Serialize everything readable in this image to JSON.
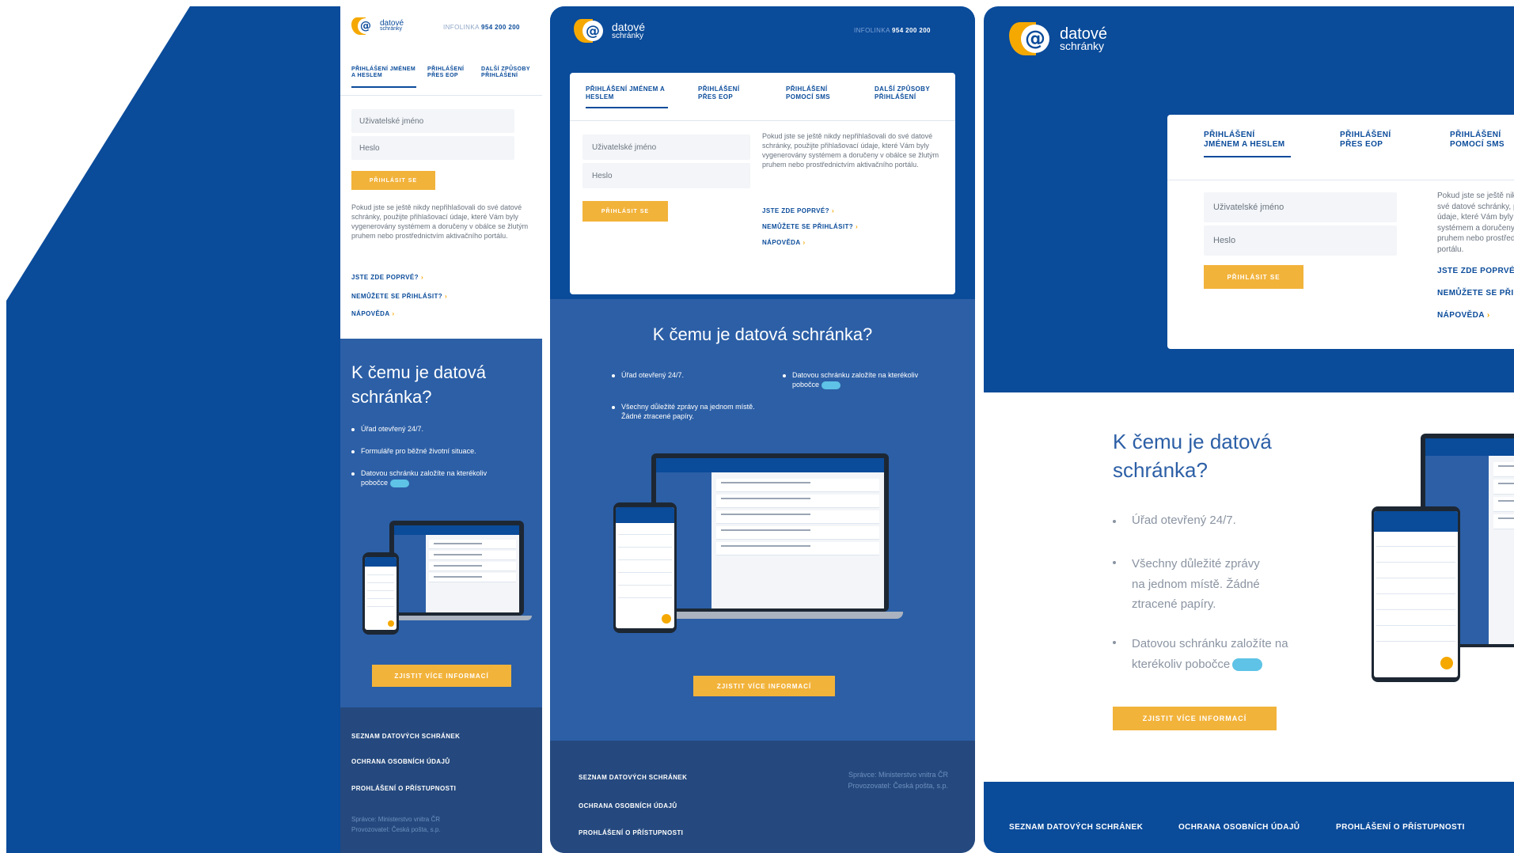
{
  "brand": {
    "name_line1": "datové",
    "name_line2": "schránky",
    "logo_char": "@"
  },
  "infolinka": {
    "label": "INFOLINKA",
    "number": "954 200 200"
  },
  "tabs": {
    "login_name": "PŘIHLÁŠENÍ JMÉNEM A HESLEM",
    "login_eop": "PŘIHLÁŠENÍ PŘES EOP",
    "login_sms": "PŘIHLÁŠENÍ POMOCÍ SMS",
    "login_other": "DALŠÍ ZPŮSOBY PŘIHLÁŠENÍ"
  },
  "form": {
    "username_placeholder": "Uživatelské jméno",
    "password_placeholder": "Heslo",
    "submit_label": "PŘIHLÁSIT SE"
  },
  "info_text": "Pokud jste se ještě nikdy nepřihlašovali do své datové schránky, použijte přihlašovací údaje, které Vám byly vygenerovány systémem a doručeny v obálce se žlutým pruhem nebo prostřednictvím aktivačního portálu.",
  "links": {
    "first_time": "JSTE ZDE POPRVÉ?",
    "cannot_login": "NEMŮŽETE SE PŘIHLÁSIT?",
    "help": "NÁPOVĚDA"
  },
  "about": {
    "heading": "K čemu je datová schránka?",
    "bullet_office": "Úřad otevřený 24/7.",
    "bullet_forms": "Formuláře pro běžné životní situace.",
    "bullet_messages": "Všechny důležité zprávy na jednom místě. Žádné ztracené papíry.",
    "bullet_branch": "Datovou schránku založíte na kterékoliv pobočce",
    "more_button": "ZJISTIT VÍCE INFORMACÍ"
  },
  "footer": {
    "list_link": "SEZNAM DATOVÝCH SCHRÁNEK",
    "privacy_link": "OCHRANA OSOBNÍCH ÚDAJŮ",
    "accessibility_link": "PROHLÁŠENÍ O PŘÍSTUPNOSTI",
    "administrator": "Správce: Ministerstvo vnitra ČR",
    "operator": "Provozovatel: Česká pošta, s.p."
  },
  "colors": {
    "primary_dark": "#0a4b9a",
    "panel_blue": "#2c5fa6",
    "footer_blue": "#25497e",
    "accent_yellow": "#f2b33b",
    "logo_yellow": "#f5a800"
  },
  "icons": {
    "chevron": "›",
    "logo": "at-sign-logo-icon",
    "branch_pill": "czech-point-pill-icon"
  }
}
